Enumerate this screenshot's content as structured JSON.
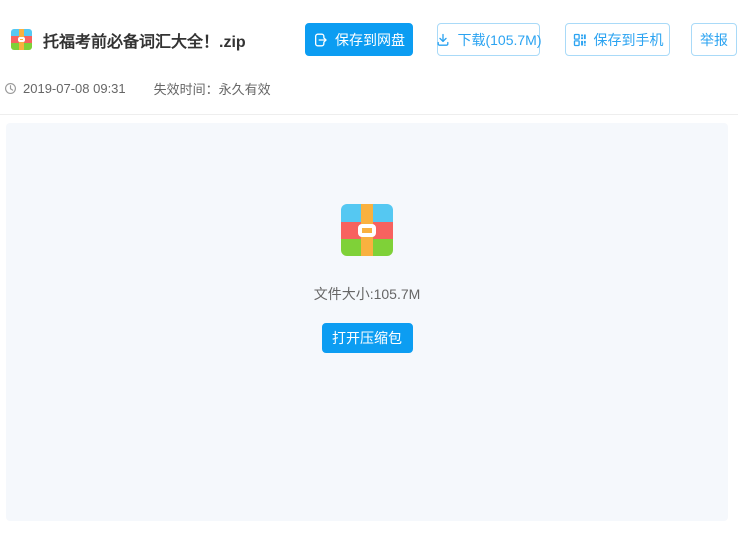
{
  "header": {
    "file_name": "托福考前必备词汇大全！.zip",
    "buttons": {
      "save_to_netdisk": "保存到网盘",
      "download": "下载(105.7M)",
      "save_to_phone": "保存到手机",
      "report": "举报"
    },
    "meta": {
      "timestamp": "2019-07-08 09:31",
      "expiry": "失效时间：永久有效"
    }
  },
  "main": {
    "file_size_label": "文件大小:105.7M",
    "open_archive_button": "打开压缩包"
  },
  "icons": {
    "file_type": "zip-archive-icon",
    "save_to_netdisk": "export-to-drive-icon",
    "download": "download-icon",
    "save_to_phone": "qr-code-icon",
    "timestamp": "clock-icon"
  },
  "colors": {
    "primary_blue": "#0C9DF2",
    "outline_button_border": "#A9DAF8",
    "outline_button_text": "#2BA3F1",
    "content_background": "#F5F8FC",
    "divider": "#EEEEEE",
    "title_text": "#333333",
    "meta_text": "#666666",
    "archive_blue": "#55C8F2",
    "archive_red": "#F7625F",
    "archive_green": "#7FD138",
    "archive_orange": "#F9B13F"
  }
}
